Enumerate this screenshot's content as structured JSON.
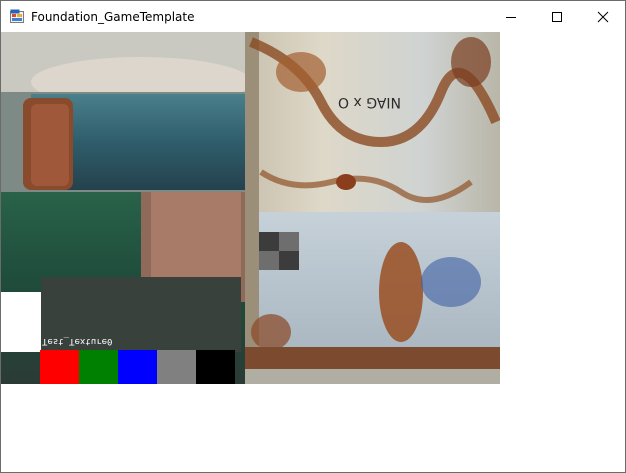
{
  "window": {
    "title": "Foundation_GameTemplate",
    "icon": "winforms-app-icon",
    "controls": [
      "minimize-icon",
      "maximize-icon",
      "close-icon"
    ]
  },
  "scene": {
    "texture": "rusty-barrel-photo",
    "debug_text": "Test_Texture0",
    "checker_colors": [
      "#3c3c3c",
      "#6e6e6e"
    ]
  },
  "palette": {
    "swatches": [
      {
        "name": "red",
        "color": "#ff0000"
      },
      {
        "name": "green",
        "color": "#008000"
      },
      {
        "name": "blue",
        "color": "#0000ff"
      },
      {
        "name": "gray",
        "color": "#808080"
      },
      {
        "name": "black",
        "color": "#000000"
      }
    ]
  }
}
